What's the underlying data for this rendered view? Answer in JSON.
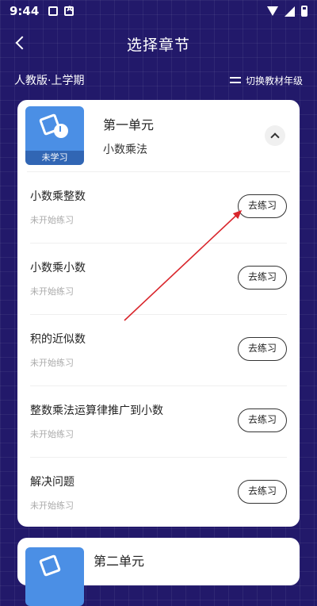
{
  "status_bar": {
    "time": "9:44"
  },
  "header": {
    "title": "选择章节"
  },
  "subbar": {
    "edition": "人教版·上学期",
    "switch_label": "切换教材年级"
  },
  "units": [
    {
      "title": "第一单元",
      "subtitle": "小数乘法",
      "badge": "未学习",
      "lessons": [
        {
          "title": "小数乘整数",
          "status": "未开始练习",
          "button": "去练习"
        },
        {
          "title": "小数乘小数",
          "status": "未开始练习",
          "button": "去练习"
        },
        {
          "title": "积的近似数",
          "status": "未开始练习",
          "button": "去练习"
        },
        {
          "title": "整数乘法运算律推广到小数",
          "status": "未开始练习",
          "button": "去练习"
        },
        {
          "title": "解决问题",
          "status": "未开始练习",
          "button": "去练习"
        }
      ]
    },
    {
      "title": "第二单元"
    }
  ],
  "colors": {
    "background": "#22196a",
    "thumbnail": "#4b8fe5",
    "annotation_arrow": "#d9262c"
  }
}
